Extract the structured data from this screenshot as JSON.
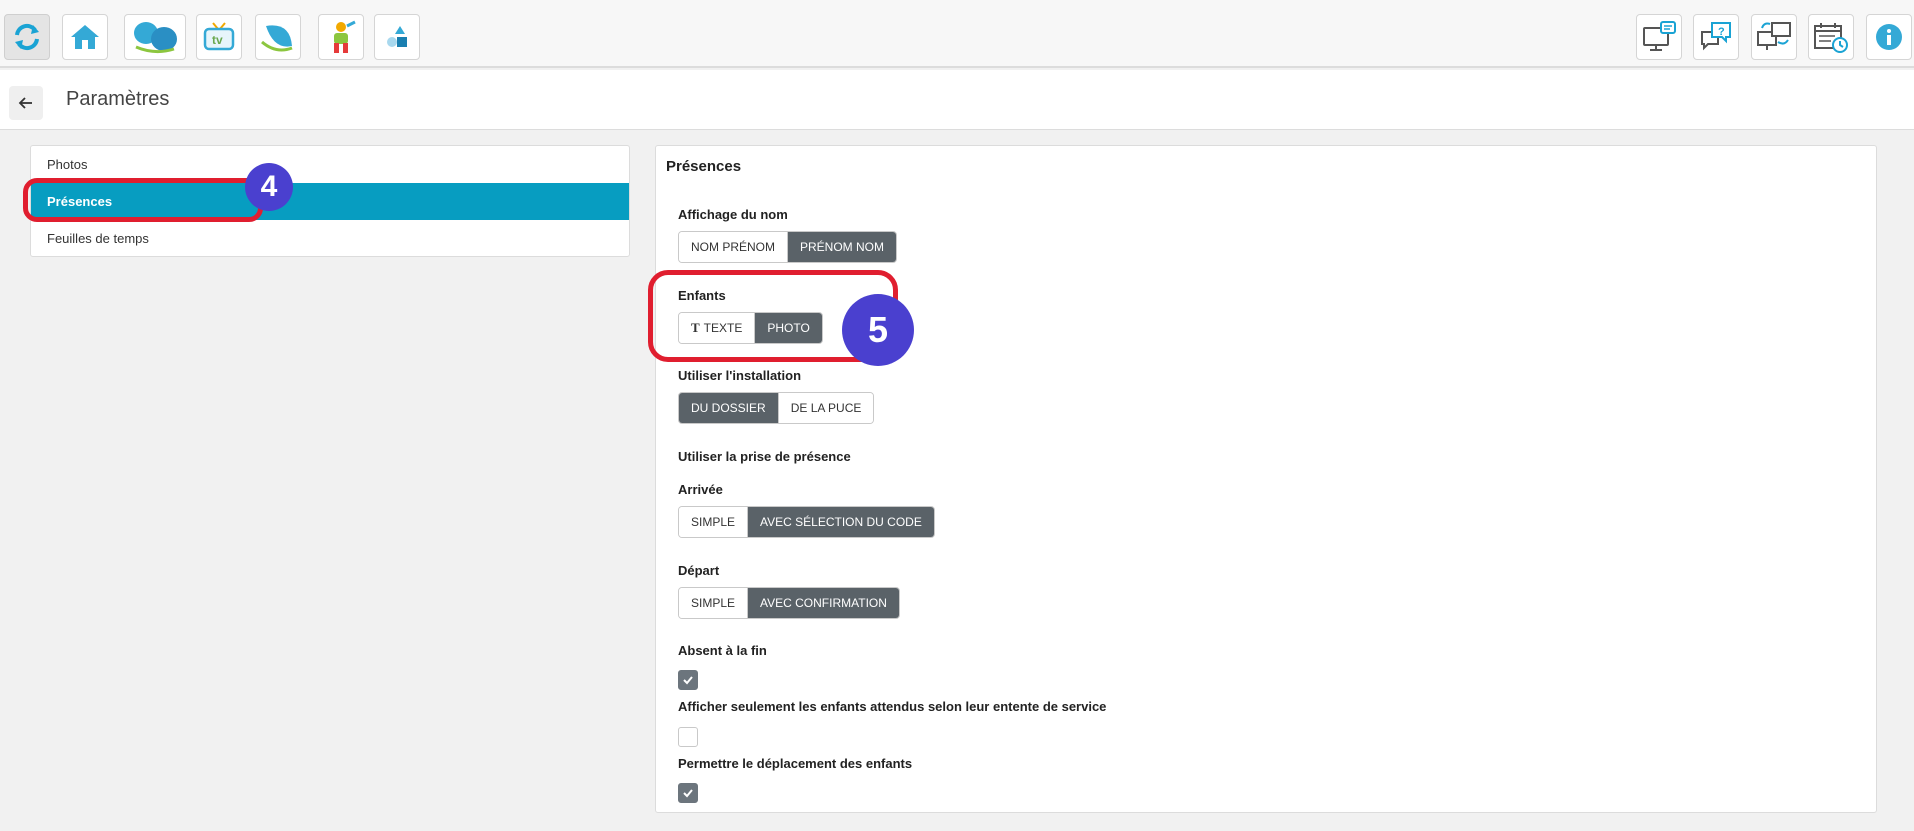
{
  "toolbar": {
    "left": [
      {
        "icon": "refresh-icon"
      },
      {
        "icon": "home-icon"
      },
      {
        "icon": "butterfly-icon"
      },
      {
        "icon": "tv-icon"
      },
      {
        "icon": "leaf-icon"
      },
      {
        "icon": "child-icon"
      },
      {
        "icon": "shapes-icon"
      }
    ],
    "right": [
      {
        "icon": "monitor-message-icon"
      },
      {
        "icon": "help-chat-icon"
      },
      {
        "icon": "sync-screens-icon"
      },
      {
        "icon": "calendar-clock-icon"
      },
      {
        "icon": "info-icon"
      }
    ]
  },
  "header": {
    "title": "Paramètres"
  },
  "menu": {
    "items": [
      {
        "label": "Photos",
        "active": false
      },
      {
        "label": "Présences",
        "active": true
      },
      {
        "label": "Feuilles de temps",
        "active": false
      }
    ]
  },
  "panel": {
    "title": "Présences",
    "name_display": {
      "label": "Affichage du nom",
      "options": [
        "NOM PRÉNOM",
        "PRÉNOM NOM"
      ],
      "selected": "PRÉNOM NOM"
    },
    "children": {
      "label": "Enfants",
      "options": [
        "TEXTE",
        "PHOTO"
      ],
      "selected": "PHOTO"
    },
    "installation": {
      "label": "Utiliser l'installation",
      "options": [
        "DU DOSSIER",
        "DE LA PUCE"
      ],
      "selected": "DU DOSSIER"
    },
    "attendance": {
      "label": "Utiliser la prise de présence"
    },
    "arrival": {
      "label": "Arrivée",
      "options": [
        "SIMPLE",
        "AVEC SÉLECTION DU CODE"
      ],
      "selected": "AVEC SÉLECTION DU CODE"
    },
    "departure": {
      "label": "Départ",
      "options": [
        "SIMPLE",
        "AVEC CONFIRMATION"
      ],
      "selected": "AVEC CONFIRMATION"
    },
    "absent_end": {
      "label": "Absent à la fin",
      "checked": true
    },
    "expected_only": {
      "label": "Afficher seulement les enfants attendus selon leur entente de service",
      "checked": false
    },
    "allow_move": {
      "label": "Permettre le déplacement des enfants",
      "checked": true
    }
  },
  "annotations": {
    "step4": "4",
    "step5": "5"
  },
  "colors": {
    "accent": "#079dc1",
    "selected": "#5a6268",
    "annotation_red": "#e01e2f",
    "annotation_badge": "#4a40cf"
  }
}
